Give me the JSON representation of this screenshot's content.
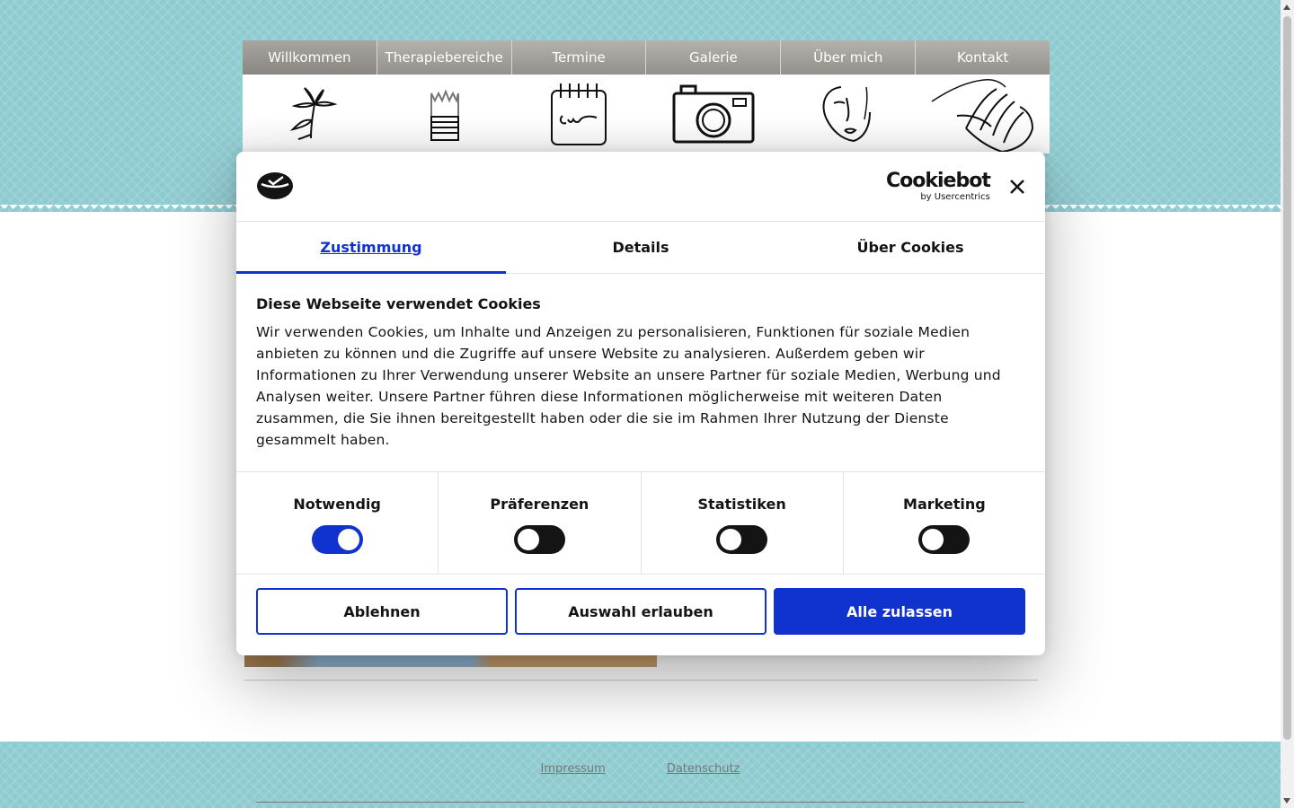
{
  "nav": {
    "items": [
      {
        "label": "Willkommen",
        "icon": "flower-icon"
      },
      {
        "label": "Therapiebereiche",
        "icon": "paintbrush-icon"
      },
      {
        "label": "Termine",
        "icon": "calendar-icon"
      },
      {
        "label": "Galerie",
        "icon": "camera-icon"
      },
      {
        "label": "Über mich",
        "icon": "face-icon"
      },
      {
        "label": "Kontakt",
        "icon": "hands-icon"
      }
    ],
    "active_index": 0
  },
  "cookie_dialog": {
    "brand": "Cookiebot",
    "brand_sub": "by Usercentrics",
    "tabs": [
      "Zustimmung",
      "Details",
      "Über Cookies"
    ],
    "active_tab": 0,
    "title": "Diese Webseite verwendet Cookies",
    "text": "Wir verwenden Cookies, um Inhalte und Anzeigen zu personalisieren, Funktionen für soziale Medien anbieten zu können und die Zugriffe auf unsere Website zu analysieren. Außerdem geben wir Informationen zu Ihrer Verwendung unserer Website an unsere Partner für soziale Medien, Werbung und Analysen weiter. Unsere Partner führen diese Informationen möglicherweise mit weiteren Daten zusammen, die Sie ihnen bereitgestellt haben oder die sie im Rahmen Ihrer Nutzung der Dienste gesammelt haben.",
    "toggles": [
      {
        "label": "Notwendig",
        "on": true
      },
      {
        "label": "Präferenzen",
        "on": false
      },
      {
        "label": "Statistiken",
        "on": false
      },
      {
        "label": "Marketing",
        "on": false
      }
    ],
    "buttons": {
      "reject": "Ablehnen",
      "allow_selection": "Auswahl erlauben",
      "allow_all": "Alle zulassen"
    }
  },
  "footer": {
    "links": [
      "Impressum",
      "Datenschutz"
    ]
  },
  "colors": {
    "accent": "#1032cf",
    "background_pattern": "#8ecbd1",
    "nav_gray": "#a29e9a"
  }
}
